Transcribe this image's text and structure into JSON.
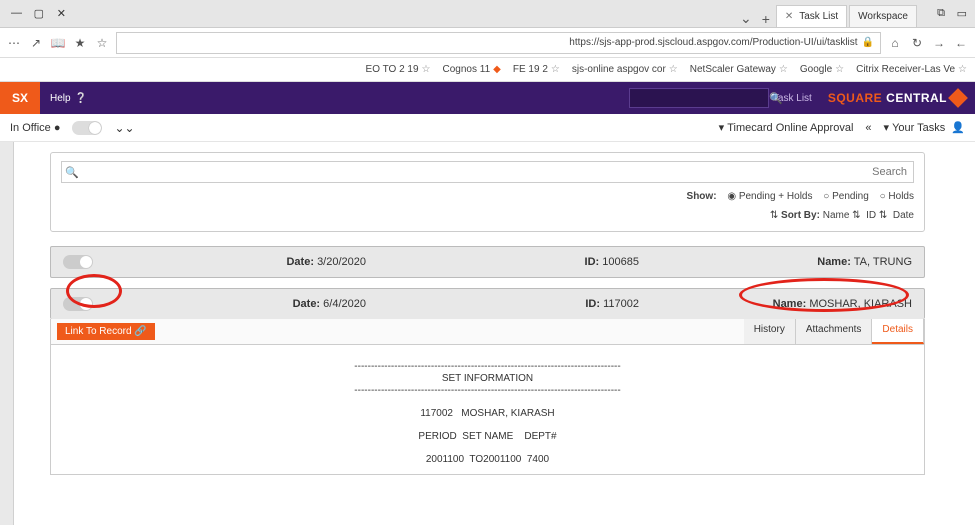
{
  "window": {
    "tabs": [
      {
        "label": "Workspace"
      },
      {
        "label": "Task List"
      }
    ],
    "url": "https://sjs-app-prod.sjscloud.aspgov.com/Production-UI/ui/tasklist"
  },
  "bookmarks": [
    "Citrix Receiver-Las Ve",
    "Google",
    "NetScaler Gateway",
    "sjs-online aspgov cor",
    "FE 19 2",
    "Cognos 11",
    "19 2 EO TO"
  ],
  "app": {
    "brand1": "CENTRAL",
    "brand2": "SQUARE",
    "subtitle": "Task List",
    "help": "Help",
    "sx": "SX"
  },
  "subheader": {
    "your_tasks": "Your Tasks ▾",
    "timecard": "Timecard Online Approval ▾",
    "in_office": "In Office"
  },
  "filters": {
    "search_placeholder": "Search",
    "show_label": "Show:",
    "opt1": "Pending + Holds",
    "opt2": "Pending",
    "opt3": "Holds",
    "sort_label": "Sort By:",
    "sort_name": "Name",
    "sort_id": "ID",
    "sort_date": "Date"
  },
  "rows": [
    {
      "name_label": "Name:",
      "name": "TA, TRUNG",
      "id_label": "ID:",
      "id": "100685",
      "date_label": "Date:",
      "date": "3/20/2020"
    },
    {
      "name_label": "Name:",
      "name": "MOSHAR, KIARASH",
      "id_label": "ID:",
      "id": "117002",
      "date_label": "Date:",
      "date": "6/4/2020"
    }
  ],
  "tabs": {
    "details": "Details",
    "attachments": "Attachments",
    "history": "History",
    "link": "Link To Record"
  },
  "memo": {
    "rule": "--------------------------------------------------------------------------------",
    "title": "SET INFORMATION",
    "hdr": "PERIOD  SET NAME    DEPT#",
    "l1": "117002   MOSHAR, KIARASH",
    "l2": "2001100  TO2001100  7400"
  }
}
